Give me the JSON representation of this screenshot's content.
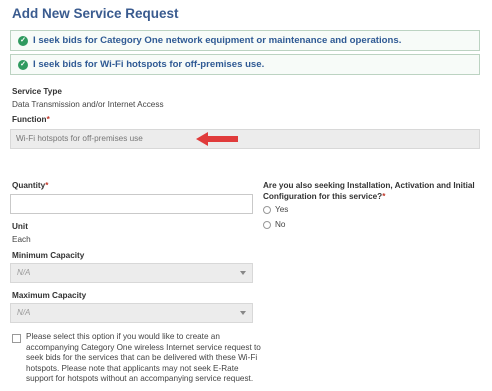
{
  "page": {
    "title": "Add New Service Request"
  },
  "options": [
    {
      "label": "I seek bids for Category One network equipment or maintenance and operations."
    },
    {
      "label": "I seek bids for Wi-Fi hotspots for off-premises use."
    }
  ],
  "service_type": {
    "label": "Service Type",
    "value": "Data Transmission and/or Internet Access"
  },
  "function": {
    "label": "Function",
    "required_mark": "*",
    "value": "Wi-Fi hotspots for off-premises use"
  },
  "quantity": {
    "label": "Quantity",
    "required_mark": "*",
    "value": ""
  },
  "unit": {
    "label": "Unit",
    "value": "Each"
  },
  "min_capacity": {
    "label": "Minimum Capacity",
    "value": "N/A"
  },
  "max_capacity": {
    "label": "Maximum Capacity",
    "value": "N/A"
  },
  "installation_question": {
    "label": "Are you also seeking Installation, Activation and Initial Configuration for this service?",
    "required_mark": "*",
    "options": [
      "Yes",
      "No"
    ]
  },
  "hotspot_checkbox": {
    "text": "Please select this option if you would like to create an accompanying Category One wireless Internet service request to seek bids for the services that can be delivered with these Wi-Fi hotspots. Please note that applicants may not seek E-Rate support for hotspots without an accompanying service request."
  },
  "colors": {
    "title": "#3a5b8f",
    "option_text": "#2f5a94",
    "check": "#2f9a5f",
    "required": "#c0392b",
    "arrow": "#e03b3b"
  }
}
